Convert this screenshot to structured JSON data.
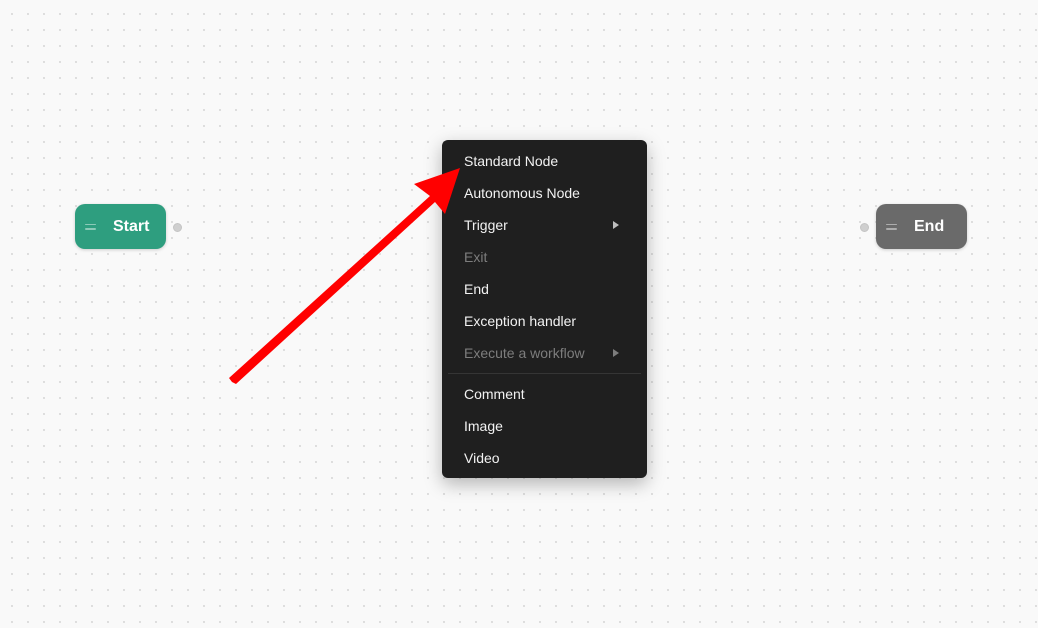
{
  "canvas": {
    "background": "#f9f9f9",
    "dot_color": "#d9d9d9"
  },
  "nodes": {
    "start": {
      "label": "Start",
      "color": "#2e9e7f",
      "icon": "drag-handle-icon"
    },
    "end": {
      "label": "End",
      "color": "#6a6a6a",
      "icon": "drag-handle-icon"
    }
  },
  "context_menu": {
    "background": "#1f1f1f",
    "items": [
      {
        "label": "Standard Node",
        "disabled": false,
        "has_submenu": false
      },
      {
        "label": "Autonomous Node",
        "disabled": false,
        "has_submenu": false
      },
      {
        "label": "Trigger",
        "disabled": false,
        "has_submenu": true
      },
      {
        "label": "Exit",
        "disabled": true,
        "has_submenu": false
      },
      {
        "label": "End",
        "disabled": false,
        "has_submenu": false
      },
      {
        "label": "Exception handler",
        "disabled": false,
        "has_submenu": false
      },
      {
        "label": "Execute a workflow",
        "disabled": true,
        "has_submenu": true
      }
    ],
    "secondary_items": [
      {
        "label": "Comment",
        "disabled": false
      },
      {
        "label": "Image",
        "disabled": false
      },
      {
        "label": "Video",
        "disabled": false
      }
    ]
  },
  "annotation": {
    "color": "#ff0000",
    "icon": "red-arrow-annotation"
  }
}
